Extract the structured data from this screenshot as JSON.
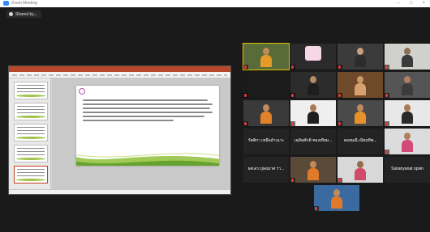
{
  "window": {
    "title": "Zoom Meeting",
    "controls": [
      "–",
      "□",
      "×"
    ]
  },
  "share": {
    "label": "Shared by..."
  },
  "participants": [
    {
      "name": "",
      "type": "video",
      "bg": "#5a6b3a",
      "head": "#c28a5a",
      "body": "#e59a2a",
      "active": true
    },
    {
      "name": "",
      "type": "badge",
      "bg": "#2b2b2b",
      "badge": "#f7d6e6"
    },
    {
      "name": "",
      "type": "video",
      "bg": "#3b3b3b",
      "head": "#caa07a",
      "body": "#2c2c2c"
    },
    {
      "name": "",
      "type": "video",
      "bg": "#d0d0cc",
      "head": "#8b6f55",
      "body": "#3a3a3a"
    },
    {
      "name": "",
      "type": "video",
      "bg": "#1b1b1b",
      "head": "#1b1b1b",
      "body": "#1b1b1b"
    },
    {
      "name": "",
      "type": "video",
      "bg": "#2c2c2c",
      "head": "#b58a65",
      "body": "#1e1e1e"
    },
    {
      "name": "",
      "type": "video",
      "bg": "#6e4a2a",
      "head": "#c89a6a",
      "body": "#d8a070"
    },
    {
      "name": "",
      "type": "video",
      "bg": "#555555",
      "head": "#b08060",
      "body": "#3c3c3c"
    },
    {
      "name": "",
      "type": "video",
      "bg": "#3a3a3a",
      "head": "#c28a5a",
      "body": "#e0822a"
    },
    {
      "name": "",
      "type": "video",
      "bg": "#efefef",
      "head": "#a87a55",
      "body": "#1f1f1f"
    },
    {
      "name": "",
      "type": "video",
      "bg": "#4a4a4a",
      "head": "#c28a5a",
      "body": "#e5922a"
    },
    {
      "name": "",
      "type": "video",
      "bg": "#e8e8e8",
      "head": "#a87a55",
      "body": "#2a2a2a"
    },
    {
      "name": "รัตติกา เหมือลำเนาะ",
      "type": "name"
    },
    {
      "name": "เฉลิมศักดิ์ ทองเทียม...",
      "type": "name"
    },
    {
      "name": "ดอยมณี เนียมทิพ...",
      "type": "name"
    },
    {
      "name": "",
      "type": "video",
      "bg": "#dcdcdc",
      "head": "#b08060",
      "body": "#d24a7a"
    },
    {
      "name": "ผศ.ดร.บุษยมาศ ว่า...",
      "type": "name"
    },
    {
      "name": "",
      "type": "video",
      "bg": "#5a4a3a",
      "head": "#c28a5a",
      "body": "#e07a2a"
    },
    {
      "name": "",
      "type": "video",
      "bg": "#d8d8d8",
      "head": "#9a6a50",
      "body": "#d24a6a"
    },
    {
      "name": "Sukanyanat opsin",
      "type": "name"
    },
    {
      "name": "",
      "type": "video",
      "bg": "#3a6aa0",
      "head": "#c28a5a",
      "body": "#e07a2a"
    }
  ]
}
